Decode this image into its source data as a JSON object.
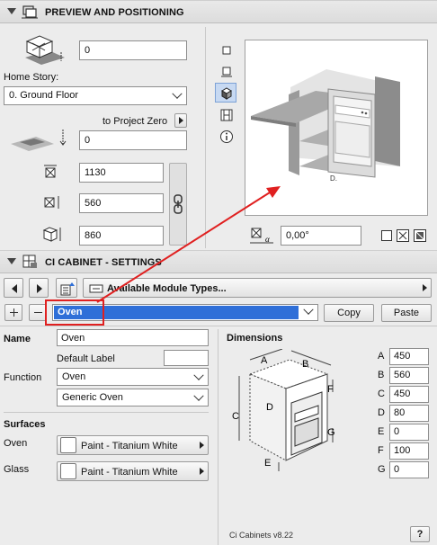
{
  "preview_section": {
    "title": "PREVIEW AND POSITIONING",
    "elevation_value": "0",
    "home_story_label": "Home Story:",
    "home_story_value": "0. Ground Floor",
    "to_project_zero_label": "to Project Zero",
    "project_zero_value": "0",
    "width_value": "1130",
    "depth_value": "560",
    "height_value": "860",
    "angle_value": "0,00°"
  },
  "cabinet_section": {
    "title": "CI CABINET - SETTINGS",
    "available_module_types": "Available Module Types...",
    "module_select_value": "Oven",
    "copy_label": "Copy",
    "paste_label": "Paste"
  },
  "properties": {
    "name_label": "Name",
    "name_value": "Oven",
    "default_label_label": "Default Label",
    "default_label_value": "",
    "function_label": "Function",
    "function_value": "Oven",
    "function_subtype": "Generic Oven",
    "surfaces_label": "Surfaces",
    "oven_label": "Oven",
    "oven_material": "Paint - Titanium White",
    "glass_label": "Glass",
    "glass_material": "Paint - Titanium White"
  },
  "dimensions": {
    "title": "Dimensions",
    "letters": [
      "A",
      "B",
      "C",
      "D",
      "E",
      "F",
      "G"
    ],
    "values": [
      "450",
      "560",
      "450",
      "80",
      "0",
      "100",
      "0"
    ],
    "diagram_letters": {
      "a": "A",
      "b": "B",
      "c": "C",
      "d": "D",
      "e": "E",
      "f": "F",
      "g": "G"
    }
  },
  "footer": {
    "version": "Ci Cabinets v8.22",
    "help": "?"
  },
  "colors": {
    "highlight_red": "#e02020",
    "selection_blue": "#2f6fd8"
  }
}
